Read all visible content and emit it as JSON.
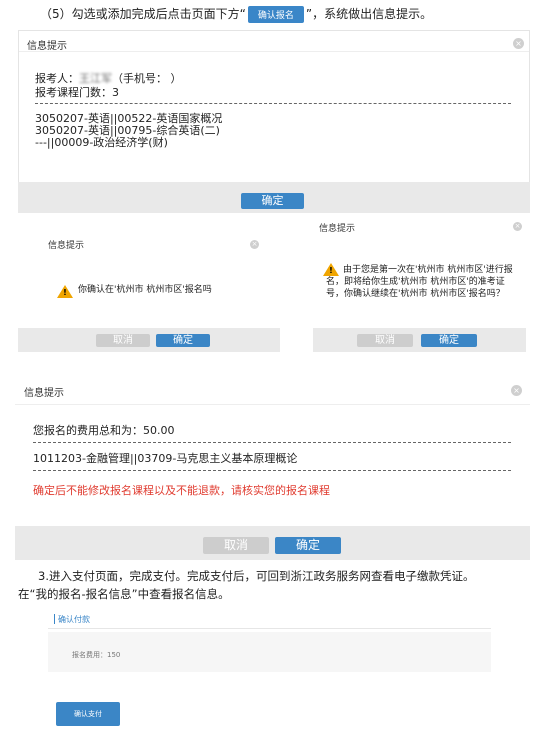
{
  "instruction_top": {
    "prefix": "（5）勾选或添加完成后点击页面下方“",
    "button_label": "确认报名",
    "suffix": "”，系统做出信息提示。"
  },
  "dialog1": {
    "title": "信息提示",
    "applicant_label": "报考人：",
    "applicant_name": "王江军",
    "phone_text": "（手机号：                  ）",
    "course_count": "报考课程门数：3",
    "courses": [
      "3050207-英语||00522-英语国家概况",
      "3050207-英语||00795-综合英语(二)",
      "---||00009-政治经济学(财)"
    ],
    "confirm_label": "确定"
  },
  "dialog2": {
    "title": "信息提示",
    "message": "你确认在'杭州市 杭州市区'报名吗",
    "cancel_label": "取消",
    "confirm_label": "确定"
  },
  "dialog3": {
    "title": "信息提示",
    "message_lines": [
      "由于您是第一次在'杭州市 杭州市区'进行报",
      "名，即将给你生成'杭州市 杭州市区'的准考证",
      "号，你确认继续在'杭州市 杭州市区'报名吗？"
    ],
    "cancel_label": "取消",
    "confirm_label": "确定"
  },
  "dialog4": {
    "title": "信息提示",
    "fee_text": "您报名的费用总和为：50.00",
    "course": "1011203-金融管理||03709-马克思主义基本原理概论",
    "warning": "确定后不能修改报名课程以及不能退款，请核实您的报名课程",
    "cancel_label": "取消",
    "confirm_label": "确定"
  },
  "instruction_step3": {
    "line1": "3.进入支付页面，完成支付。完成支付后，可回到浙江政务服务网查看电子缴款凭证。",
    "line2": "在“我的报名-报名信息”中查看报名信息。"
  },
  "payment": {
    "section_label": "确认付款",
    "fee_text": "报名费用：150",
    "pay_button": "确认支付"
  },
  "colors": {
    "accent": "#3b86c6",
    "warning_red": "#e03b2f",
    "warning_icon": "#f0a500"
  },
  "icons": [
    "close-icon",
    "warning-icon"
  ]
}
